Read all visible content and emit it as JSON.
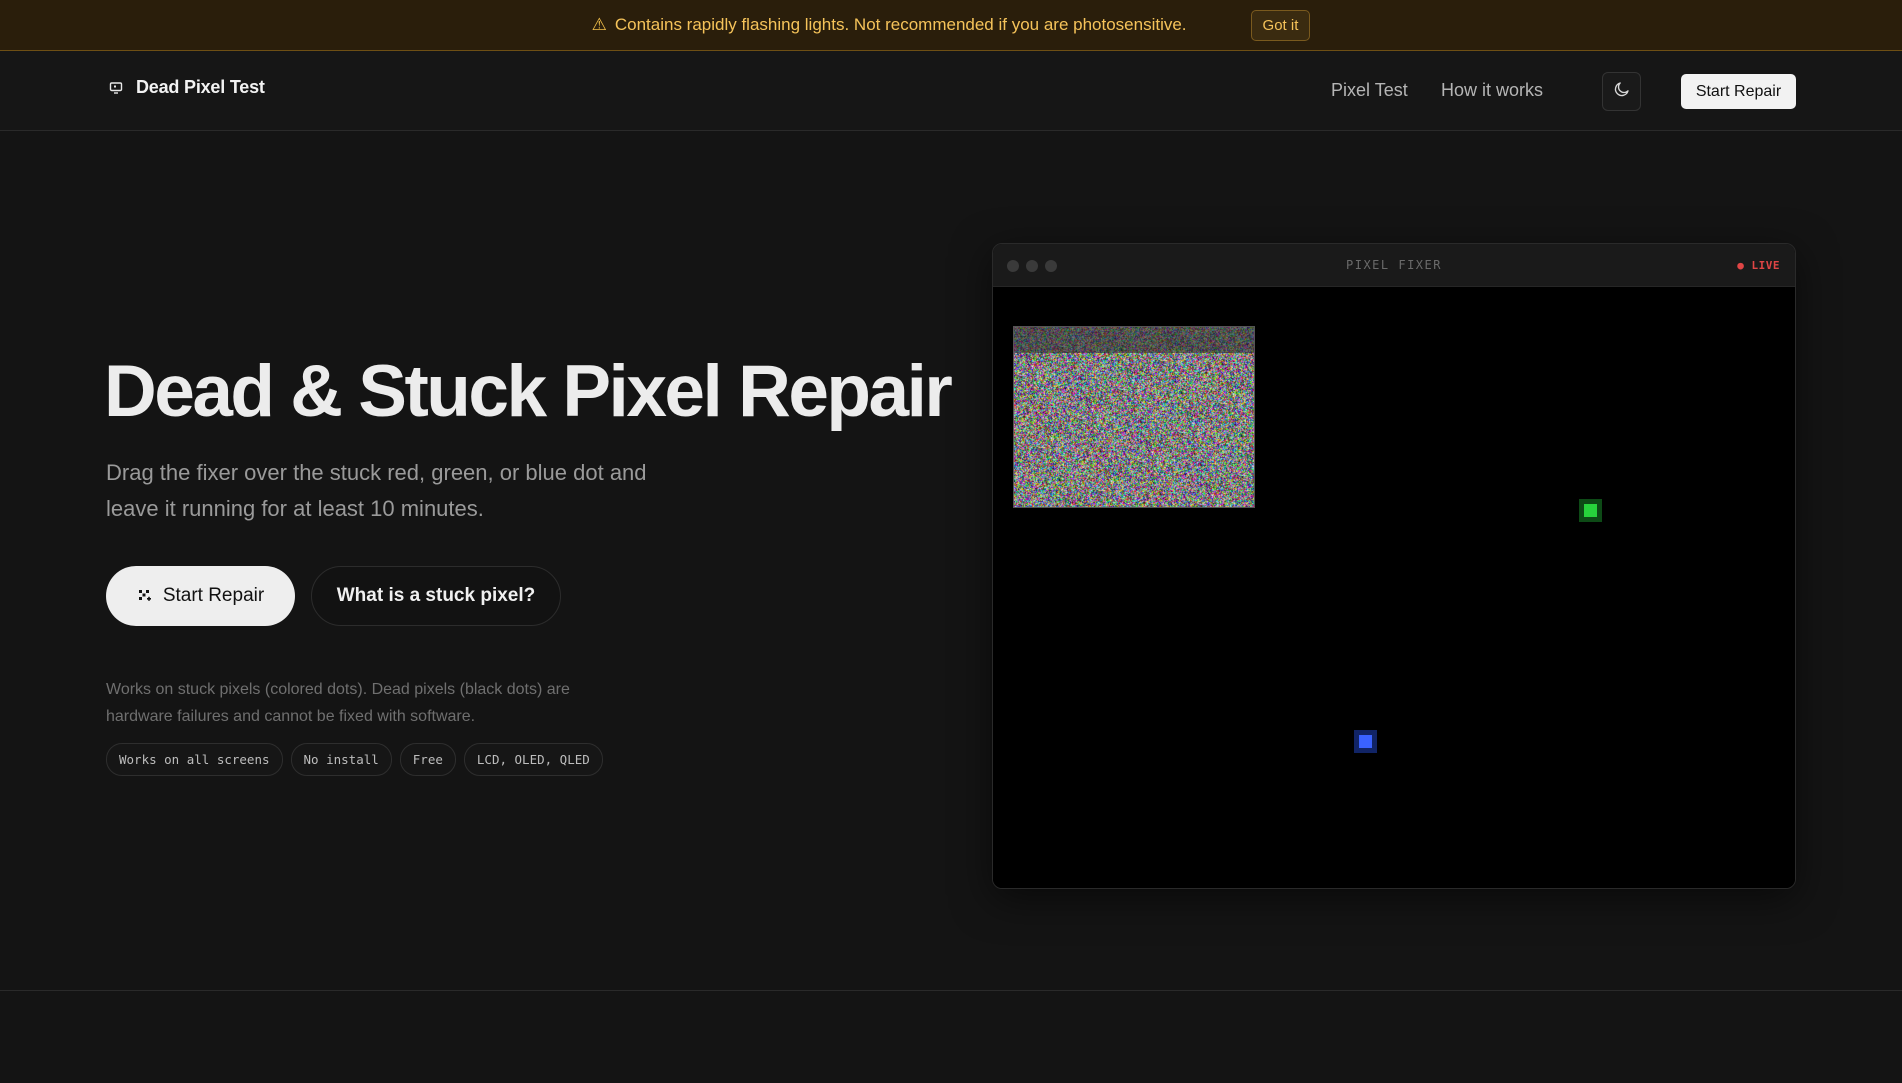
{
  "banner": {
    "warning_icon": "warning-triangle-icon",
    "message": "Contains rapidly flashing lights. Not recommended if you are photosensitive.",
    "dismiss_label": "Got it"
  },
  "nav": {
    "brand_icon": "monitor-icon",
    "brand_name": "Dead Pixel Test",
    "links": [
      "Pixel Test",
      "How it works"
    ],
    "theme_toggle_icon": "moon-icon",
    "cta_label": "Start Repair"
  },
  "hero": {
    "title": "Dead & Stuck Pixel Repair",
    "subtitle": "Drag the fixer over the stuck red, green, or blue dot and leave it running for at least 10 minutes.",
    "primary_button": "Start Repair",
    "primary_button_icon": "sparkle-pixels-icon",
    "secondary_button": "What is a stuck pixel?",
    "note": "Works on stuck pixels (colored dots). Dead pixels (black dots) are hardware failures and cannot be fixed with software.",
    "chips": [
      "Works on all screens",
      "No install",
      "Free",
      "LCD, OLED, QLED"
    ]
  },
  "fixer": {
    "title": "PIXEL FIXER",
    "live_label": "● LIVE",
    "stuck_pixel_colors": {
      "green": "#27d23c",
      "blue": "#3a62ff"
    }
  },
  "colors": {
    "background": "#141414",
    "banner_bg": "#2a1e0b",
    "banner_text": "#f5c35a",
    "live_red": "#e04545"
  }
}
